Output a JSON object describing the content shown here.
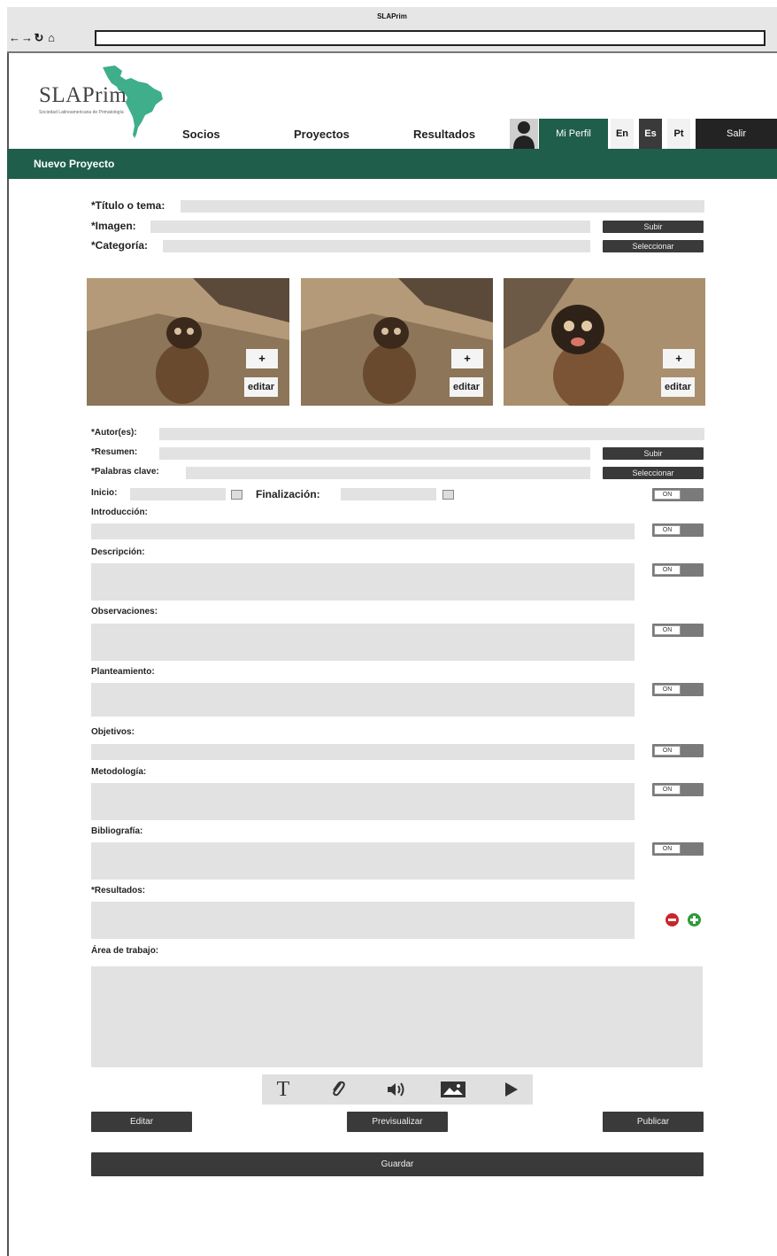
{
  "browser": {
    "title": "SLAPrim",
    "nav_icons": [
      "back-arrow-icon",
      "forward-arrow-icon",
      "reload-icon",
      "home-icon"
    ],
    "url": ""
  },
  "site": {
    "logo": "SLAPrim",
    "logo_subtitle": "Sociedad Latinoamericana de Primatología",
    "nav": [
      "Socios",
      "Proyectos",
      "Resultados"
    ],
    "profile": "Mi Perfil",
    "languages": [
      "En",
      "Es",
      "Pt"
    ],
    "logout": "Salir",
    "colors": {
      "brand": "#1f5e4b",
      "dark": "#232323",
      "field": "#e2e2e2"
    }
  },
  "page": {
    "title": "Nuevo Proyecto"
  },
  "form": {
    "titulo": "*Título o tema:",
    "imagen": "*Imagen:",
    "categoria": "*Categoría:",
    "subir": "Subir",
    "seleccionar": "Seleccionar",
    "photo_plus": "+",
    "photo_edit": "editar",
    "autores": "*Autor(es):",
    "resumen": "*Resumen:",
    "palabras": "*Palabras clave:",
    "inicio": "Inicio:",
    "finalizacion": "Finalización:",
    "toggle_on": "ON",
    "introduccion": "Introducción:",
    "descripcion": "Descripción:",
    "observaciones": "Observaciones:",
    "planteamiento": "Planteamiento:",
    "objetivos": "Objetivos:",
    "metodologia": "Metodología:",
    "bibliografia": "Bibliografía:",
    "resultados": "*Resultados:",
    "area": "Área de trabajo:",
    "toolbar_icons": [
      "text-icon",
      "attachment-icon",
      "audio-icon",
      "image-icon",
      "video-play-icon"
    ],
    "editar": "Editar",
    "previsualizar": "Previsualizar",
    "publicar": "Publicar",
    "guardar": "Guardar"
  }
}
